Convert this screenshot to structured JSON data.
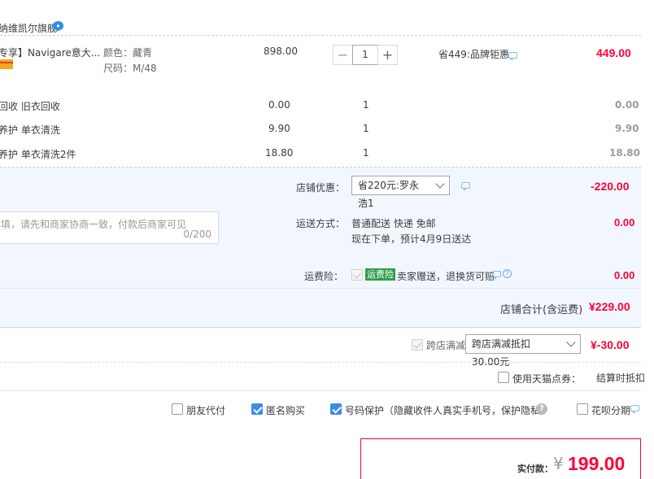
{
  "shop": {
    "name": "纳维凯尔旗舰"
  },
  "item": {
    "title": "专享】Navigare意大...",
    "color_label": "颜色：藏青",
    "size_label": "尺码：M/48",
    "unit_price": "898.00",
    "quantity": "1",
    "promo": "省449:品牌钜惠",
    "subtotal": "449.00"
  },
  "services": [
    {
      "name": "回收 旧衣回收",
      "price": "0.00",
      "qty": "1",
      "subtotal": "0.00"
    },
    {
      "name": "养护 单衣清洗",
      "price": "9.90",
      "qty": "1",
      "subtotal": "9.90"
    },
    {
      "name": "养护 单衣清洗2件",
      "price": "18.80",
      "qty": "1",
      "subtotal": "18.80"
    }
  ],
  "shop_discount": {
    "label": "店铺优惠：",
    "selected": "省220元:罗永浩1",
    "amount": "-220.00"
  },
  "message_box": {
    "placeholder": "填，请先和商家协商一致，付款后商家可见",
    "counter": "0/200"
  },
  "shipping": {
    "label": "运送方式：",
    "method": "普通配送 快递 免邮",
    "eta": "现在下单，预计4月9日送达",
    "amount": "0.00"
  },
  "shipping_insurance": {
    "label": "运费险：",
    "badge": "运费险",
    "text": "卖家赠送，退换货可赔",
    "amount": "0.00"
  },
  "shop_total": {
    "label": "店铺合计(含运费)",
    "amount": "¥229.00"
  },
  "cross_store": {
    "label": "跨店满减",
    "selected": "跨店满减抵扣30.00元",
    "amount": "¥-30.00"
  },
  "tmall_points": {
    "label": "使用天猫点券：",
    "note": "结算时抵扣"
  },
  "options": {
    "friend_pay": "朋友代付",
    "anonymous": "匿名购买",
    "number_protect": "号码保护（隐藏收件人真实手机号，保护隐私）",
    "huabei": "花呗分期"
  },
  "payment": {
    "label": "实付款：",
    "currency": "¥",
    "amount": "199.00"
  },
  "colors": {
    "price_red": "#ff0036",
    "accent_blue": "#3b8ce8",
    "band": "#f2f7ff"
  }
}
